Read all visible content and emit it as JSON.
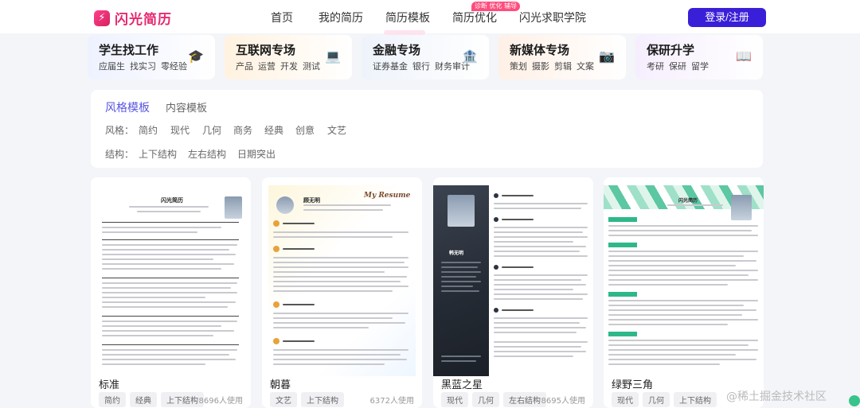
{
  "nav": {
    "logo_text": "闪光简历",
    "links": [
      "首页",
      "我的简历",
      "简历模板",
      "简历优化",
      "闪光求职学院"
    ],
    "badge": "诊断 优化 辅导",
    "login": "登录/注册"
  },
  "categories": [
    {
      "title": "学生找工作",
      "tags": [
        "应届生",
        "找实习",
        "零经验"
      ],
      "icon": "graduation-cap-icon",
      "glyph": "🎓",
      "color": "#eef2ff"
    },
    {
      "title": "互联网专场",
      "tags": [
        "产品",
        "运营",
        "开发",
        "测试"
      ],
      "icon": "laptop-icon",
      "glyph": "💻",
      "color": "#fff2e0"
    },
    {
      "title": "金融专场",
      "tags": [
        "证券基金",
        "银行",
        "财务审计"
      ],
      "icon": "bank-icon",
      "glyph": "🏦",
      "color": "#eef3fb"
    },
    {
      "title": "新媒体专场",
      "tags": [
        "策划",
        "摄影",
        "剪辑",
        "文案"
      ],
      "icon": "camera-icon",
      "glyph": "📷",
      "color": "#fff0e6"
    },
    {
      "title": "保研升学",
      "tags": [
        "考研",
        "保研",
        "留学"
      ],
      "icon": "book-icon",
      "glyph": "📖",
      "color": "#f6eefe"
    }
  ],
  "filter": {
    "tabs": [
      "风格模板",
      "内容模板"
    ],
    "style_label": "风格：",
    "style_options": [
      "简约",
      "现代",
      "几何",
      "商务",
      "经典",
      "创意",
      "文艺"
    ],
    "structure_label": "结构：",
    "structure_options": [
      "上下结构",
      "左右结构",
      "日期突出"
    ]
  },
  "templates": [
    {
      "name": "标准",
      "tags": [
        "简约",
        "经典",
        "上下结构"
      ],
      "uses": "8696人使用",
      "accent": "#333333",
      "header_name": "闪光简历"
    },
    {
      "name": "朝暮",
      "tags": [
        "文艺",
        "上下结构"
      ],
      "uses": "6372人使用",
      "accent": "#e8a23c",
      "header_name": "顾无明",
      "script": "My Resume"
    },
    {
      "name": "黑蓝之星",
      "tags": [
        "现代",
        "几何",
        "左右结构"
      ],
      "uses": "8695人使用",
      "accent": "#2c3340",
      "header_name": "韩无明"
    },
    {
      "name": "绿野三角",
      "tags": [
        "现代",
        "几何",
        "上下结构"
      ],
      "uses": "",
      "accent": "#2eb88a",
      "header_name": "闪光简历"
    }
  ],
  "watermark": "@稀土掘金技术社区"
}
